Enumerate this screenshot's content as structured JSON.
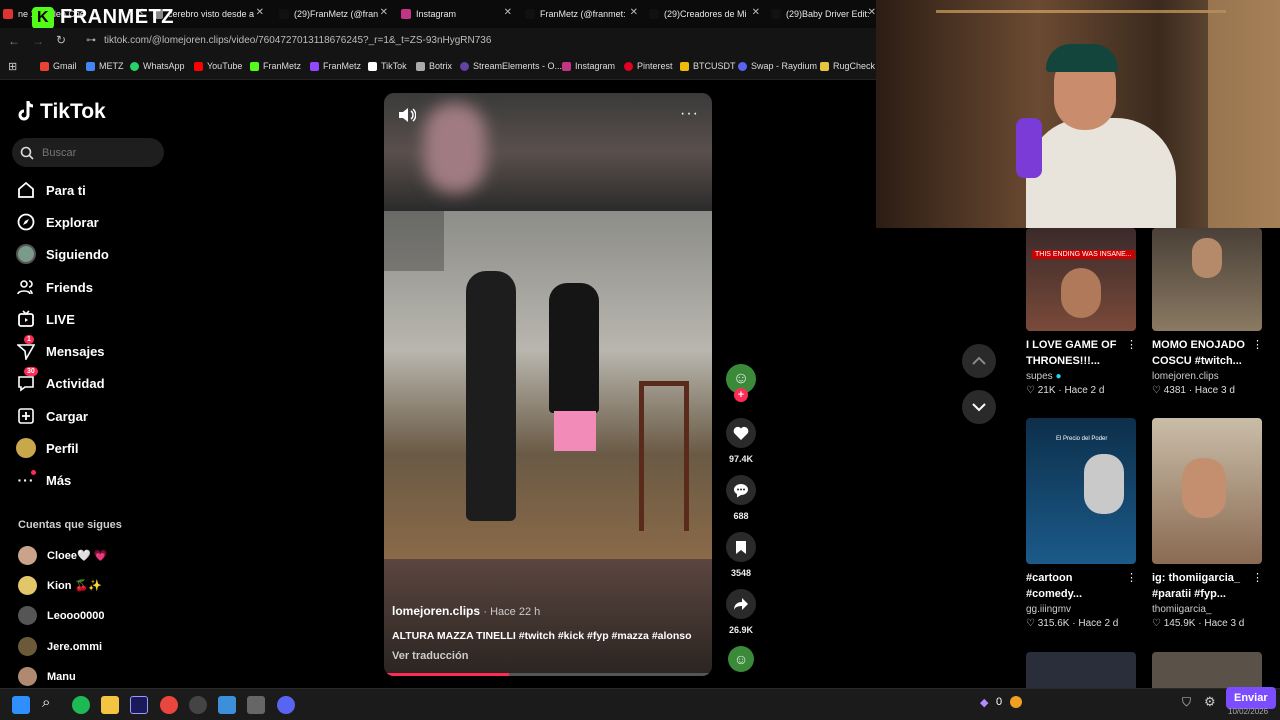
{
  "browser": {
    "tabs": [
      {
        "title": "ne 14 Video Che",
        "color": "#d33"
      },
      {
        "title": "cerebro visto desde a",
        "color": "#888"
      },
      {
        "title": "(29)FranMetz (@fran",
        "color": "#111"
      },
      {
        "title": "Instagram",
        "color": "#c13584"
      },
      {
        "title": "FranMetz (@franmet:",
        "color": "#111"
      },
      {
        "title": "(29)Creadores de Mi",
        "color": "#111"
      },
      {
        "title": "(29)Baby Driver Edit:",
        "color": "#111"
      }
    ],
    "url": "tiktok.com/@lomejoren.clips/video/7604727013118676245?_r=1&_t=ZS-93nHygRN736",
    "bookmarks": [
      {
        "label": "Gmail",
        "color": "#ea4335"
      },
      {
        "label": "METZ",
        "color": "#4285f4"
      },
      {
        "label": "WhatsApp",
        "color": "#25d366"
      },
      {
        "label": "YouTube",
        "color": "#ff0000"
      },
      {
        "label": "FranMetz",
        "color": "#53fc18"
      },
      {
        "label": "FranMetz",
        "color": "#9146ff"
      },
      {
        "label": "TikTok",
        "color": "#ffffff"
      },
      {
        "label": "Botrix",
        "color": "#aaaaaa"
      },
      {
        "label": "StreamElements - O...",
        "color": "#6441a5"
      },
      {
        "label": "Instagram",
        "color": "#c13584"
      },
      {
        "label": "Pinterest",
        "color": "#e60023"
      },
      {
        "label": "BTCUSDT",
        "color": "#f0b90b"
      },
      {
        "label": "Swap - Raydium",
        "color": "#5865f2"
      },
      {
        "label": "RugCheck",
        "color": "#e4c441"
      }
    ]
  },
  "brand_overlay": {
    "text": "FRANMETZ",
    "letter": "K"
  },
  "sidebar": {
    "logo": "TikTok",
    "search_placeholder": "Buscar",
    "nav": [
      {
        "label": "Para ti",
        "icon": "home-icon"
      },
      {
        "label": "Explorar",
        "icon": "compass-icon"
      },
      {
        "label": "Siguiendo",
        "icon": "following-avatar-icon"
      },
      {
        "label": "Friends",
        "icon": "friends-icon"
      },
      {
        "label": "LIVE",
        "icon": "live-icon"
      },
      {
        "label": "Mensajes",
        "icon": "messages-icon",
        "badge": "1"
      },
      {
        "label": "Actividad",
        "icon": "activity-icon",
        "badge": "30"
      },
      {
        "label": "Cargar",
        "icon": "upload-icon"
      },
      {
        "label": "Perfil",
        "icon": "profile-avatar-icon"
      },
      {
        "label": "Más",
        "icon": "more-icon"
      }
    ],
    "following_heading": "Cuentas que sigues",
    "following": [
      {
        "name": "Cloee🤍 💗",
        "color": "#c9a48a"
      },
      {
        "name": "Kion 🍒✨",
        "color": "#e2c66a"
      },
      {
        "name": "Leooo0000",
        "color": "#555555"
      },
      {
        "name": "Jere.ommi",
        "color": "#6a5a3a"
      },
      {
        "name": "Manu",
        "color": "#b08a70"
      }
    ]
  },
  "video": {
    "author": "lomejoren.clips",
    "time": "· Hace 22 h",
    "caption": "ALTURA MAZZA TINELLI #twitch #kick #fyp #mazza #alonso",
    "translate": "Ver traducción",
    "progress": 0.38
  },
  "actions": {
    "likes": "97.4K",
    "comments": "688",
    "saves": "3548",
    "shares": "26.9K"
  },
  "grid": [
    {
      "title": "I LOVE GAME OF THRONES!!!...",
      "user": "supes",
      "verified": true,
      "likes": "21K",
      "time": "Hace 2 d",
      "thumb_text": "THIS ENDING WAS INSANE..."
    },
    {
      "title": "MOMO ENOJADO COSCU #twitch...",
      "user": "lomejoren.clips",
      "verified": false,
      "likes": "4381",
      "time": "Hace 3 d",
      "thumb_text": ""
    },
    {
      "title": "#cartoon #comedy...",
      "user": "gg.iiingmv",
      "verified": false,
      "likes": "315.6K",
      "time": "Hace 2 d",
      "thumb_text": "El Precio del Poder"
    },
    {
      "title": "ig: thomiigarcia_ #paratii #fyp...",
      "user": "thomiigarcia_",
      "verified": false,
      "likes": "145.9K",
      "time": "Hace 3 d",
      "thumb_text": ""
    }
  ],
  "tray": {
    "points": "0",
    "send_label": "Enviar",
    "date": "10/02/2026"
  }
}
